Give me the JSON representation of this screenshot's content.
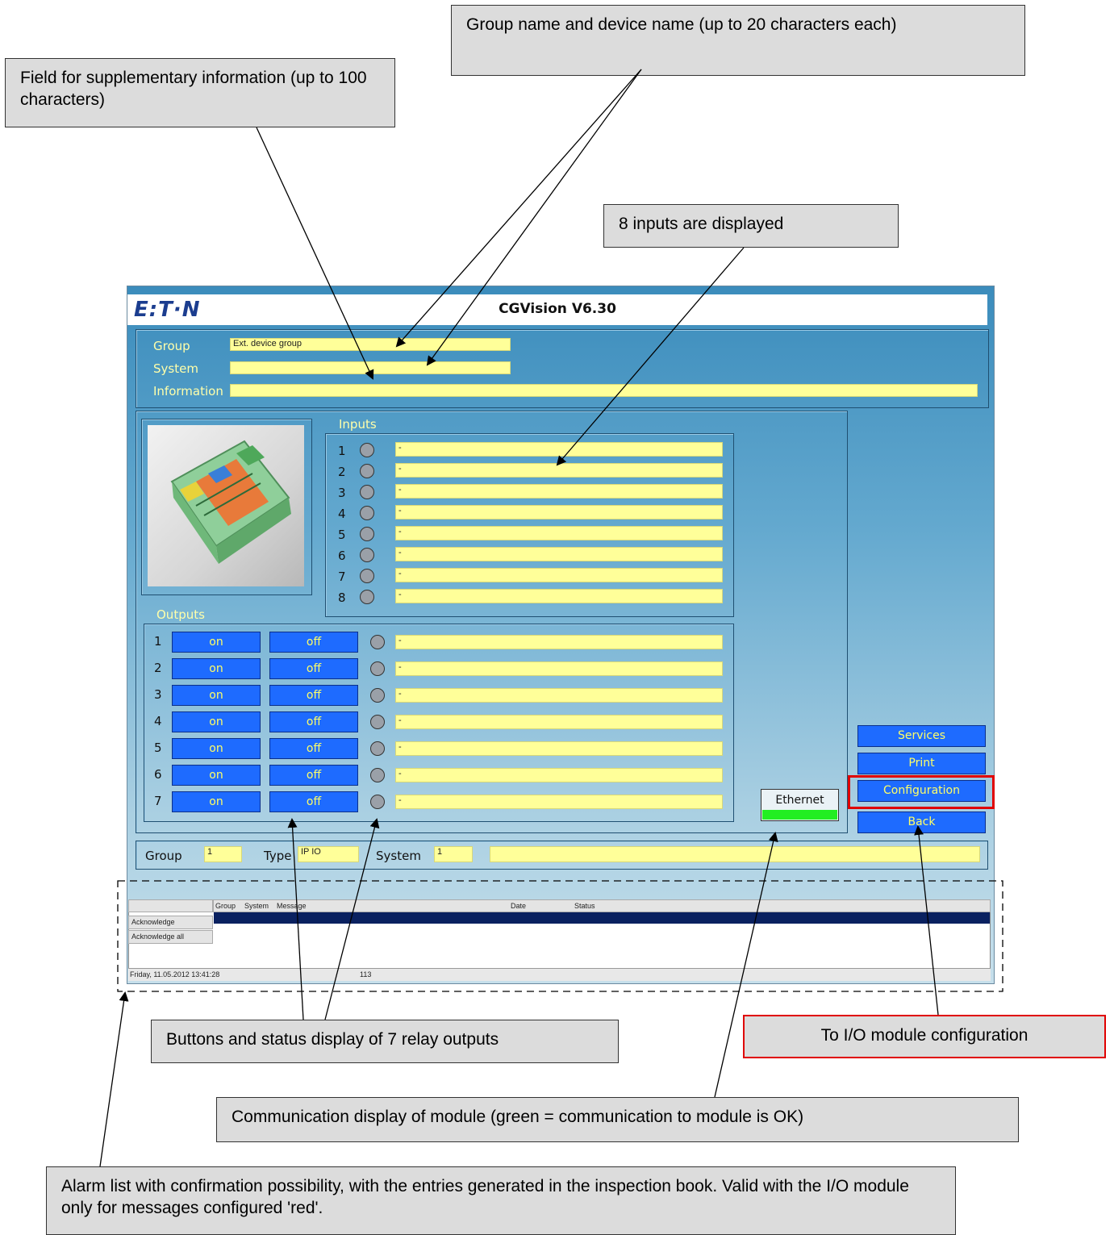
{
  "callouts": {
    "supplementary": "Field for supplementary information (up to 100 characters)",
    "group_device": "Group name and device name (up to 20 characters each)",
    "inputs": "8 inputs are displayed",
    "outputs": "Buttons and status display of 7 relay outputs",
    "io_config": "To I/O module configuration",
    "communication": "Communication display of module (green = communication to module is OK)",
    "alarm_list": "Alarm list with confirmation possibility, with the entries generated in the inspection book. Valid with the I/O module only for messages configured 'red'."
  },
  "app": {
    "logo": "E:T·N",
    "title": "CGVision V6.30"
  },
  "header": {
    "group_label": "Group",
    "group_value": "Ext. device group",
    "system_label": "System",
    "system_value": "",
    "information_label": "Information",
    "information_value": ""
  },
  "inputs": {
    "label": "Inputs",
    "items": [
      {
        "num": "1",
        "text": "-"
      },
      {
        "num": "2",
        "text": "-"
      },
      {
        "num": "3",
        "text": "-"
      },
      {
        "num": "4",
        "text": "-"
      },
      {
        "num": "5",
        "text": "-"
      },
      {
        "num": "6",
        "text": "-"
      },
      {
        "num": "7",
        "text": "-"
      },
      {
        "num": "8",
        "text": "-"
      }
    ]
  },
  "outputs": {
    "label": "Outputs",
    "on_label": "on",
    "off_label": "off",
    "items": [
      {
        "num": "1",
        "text": "-"
      },
      {
        "num": "2",
        "text": "-"
      },
      {
        "num": "3",
        "text": "-"
      },
      {
        "num": "4",
        "text": "-"
      },
      {
        "num": "5",
        "text": "-"
      },
      {
        "num": "6",
        "text": "-"
      },
      {
        "num": "7",
        "text": "-"
      }
    ]
  },
  "side_buttons": {
    "services": "Services",
    "print": "Print",
    "configuration": "Configuration",
    "back": "Back"
  },
  "ethernet": {
    "label": "Ethernet",
    "status_color": "#22ee22"
  },
  "footer": {
    "group_label": "Group",
    "group_value": "1",
    "type_label": "Type",
    "type_value": "IP IO",
    "system_label": "System",
    "system_value": "1",
    "extra_value": ""
  },
  "alarm_table": {
    "acknowledge": "Acknowledge",
    "acknowledge_all": "Acknowledge all",
    "columns": [
      "Group",
      "System",
      "Message",
      "Date",
      "Status"
    ],
    "status_datetime": "Friday, 11.05.2012 13:41:28",
    "status_count": "113"
  },
  "colors": {
    "field_yellow": "#ffff99",
    "button_blue": "#1e6bff",
    "label_yellow": "#ffffaa",
    "highlight_red": "#e00000"
  }
}
